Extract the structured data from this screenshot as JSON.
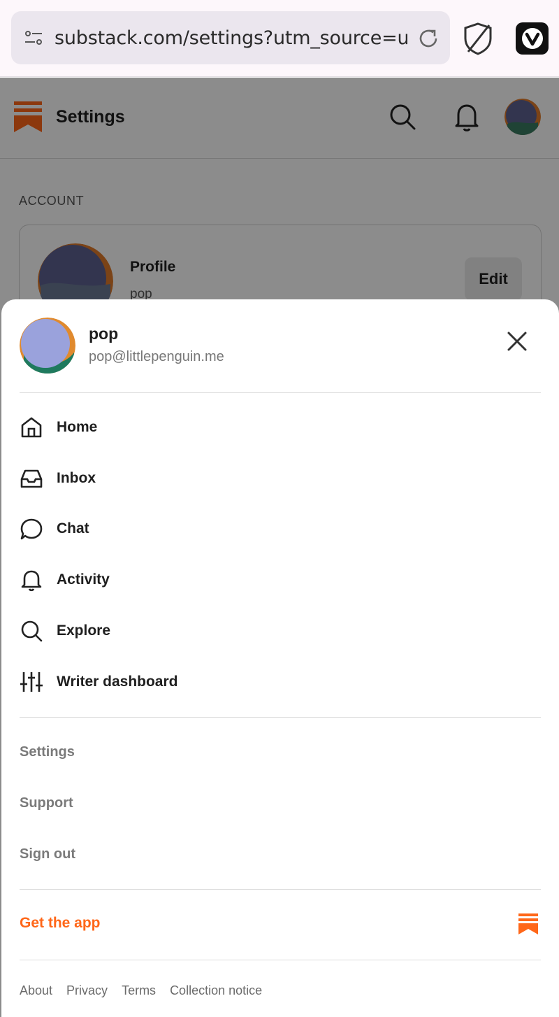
{
  "browser": {
    "url": "substack.com/settings?utm_source=user-",
    "icons": [
      "tune-icon",
      "reload-icon",
      "shield-icon",
      "vivaldi-icon"
    ]
  },
  "page": {
    "title": "Settings",
    "section_label": "ACCOUNT",
    "profile": {
      "label": "Profile",
      "name": "pop",
      "edit_label": "Edit"
    }
  },
  "sheet": {
    "user": {
      "name": "pop",
      "email": "pop@littlepenguin.me"
    },
    "nav_items": [
      {
        "label": "Home",
        "icon": "home-icon"
      },
      {
        "label": "Inbox",
        "icon": "inbox-icon"
      },
      {
        "label": "Chat",
        "icon": "chat-icon"
      },
      {
        "label": "Activity",
        "icon": "bell-icon"
      },
      {
        "label": "Explore",
        "icon": "search-icon"
      },
      {
        "label": "Writer dashboard",
        "icon": "sliders-icon"
      }
    ],
    "secondary": [
      "Settings",
      "Support",
      "Sign out"
    ],
    "get_app": "Get the app",
    "footer_links": [
      "About",
      "Privacy",
      "Terms",
      "Collection notice"
    ]
  },
  "colors": {
    "brand": "#ff6719",
    "overlay": "rgba(0,0,0,0.45)"
  }
}
